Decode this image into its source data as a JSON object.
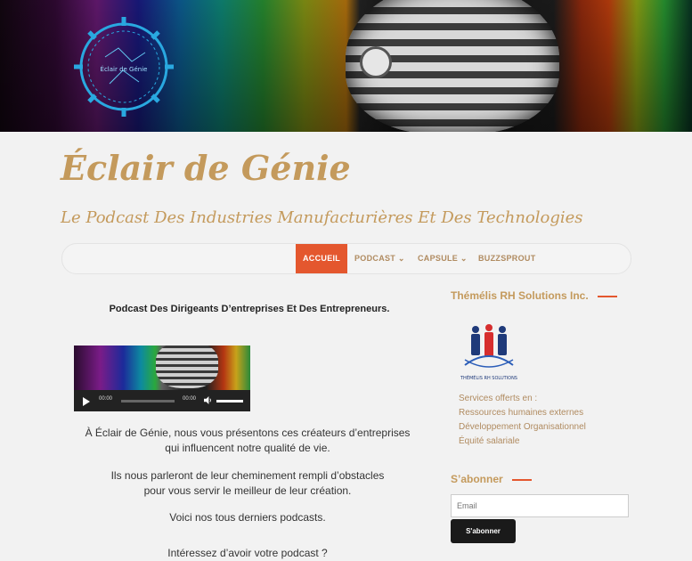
{
  "site": {
    "title": "Éclair de Génie",
    "description": "Le Podcast Des Industries Manufacturières Et Des Technologies"
  },
  "header": {
    "logo_text": "Éclair de Génie"
  },
  "nav": {
    "items": [
      {
        "label": "ACCUEIL",
        "active": true
      },
      {
        "label": "PODCAST ⌄"
      },
      {
        "label": "CAPSULE ⌄"
      },
      {
        "label": "BUZZSPROUT"
      }
    ]
  },
  "main": {
    "heading": "Podcast Des Dirigeants D’entreprises Et Des Entrepreneurs.",
    "player": {
      "current_time": "00:00",
      "duration": "00:00"
    },
    "paragraphs": [
      "À Éclair de Génie, nous vous présentons ces créateurs d’entreprises",
      "qui influencent notre qualité de vie.",
      "Ils nous parleront de leur cheminement rempli d’obstacles",
      "pour vous servir le meilleur de leur création.",
      "Voici nos tous derniers podcasts.",
      "Intéressez d’avoir votre podcast ?"
    ]
  },
  "sidebar": {
    "widget1": {
      "title": "Thémélis RH Solutions Inc.",
      "logo_caption": "THÉMÉLIS RH SOLUTIONS",
      "services": [
        "Services offerts en :",
        "Ressources humaines externes",
        "Développement Organisationnel",
        "Équité salariale"
      ]
    },
    "widget2": {
      "title": "S’abonner",
      "email_placeholder": "Email",
      "button_label": "S'abonner"
    }
  },
  "colors": {
    "accent": "#e4572e",
    "gold": "#c49a5c",
    "background": "#f2f2f2"
  }
}
